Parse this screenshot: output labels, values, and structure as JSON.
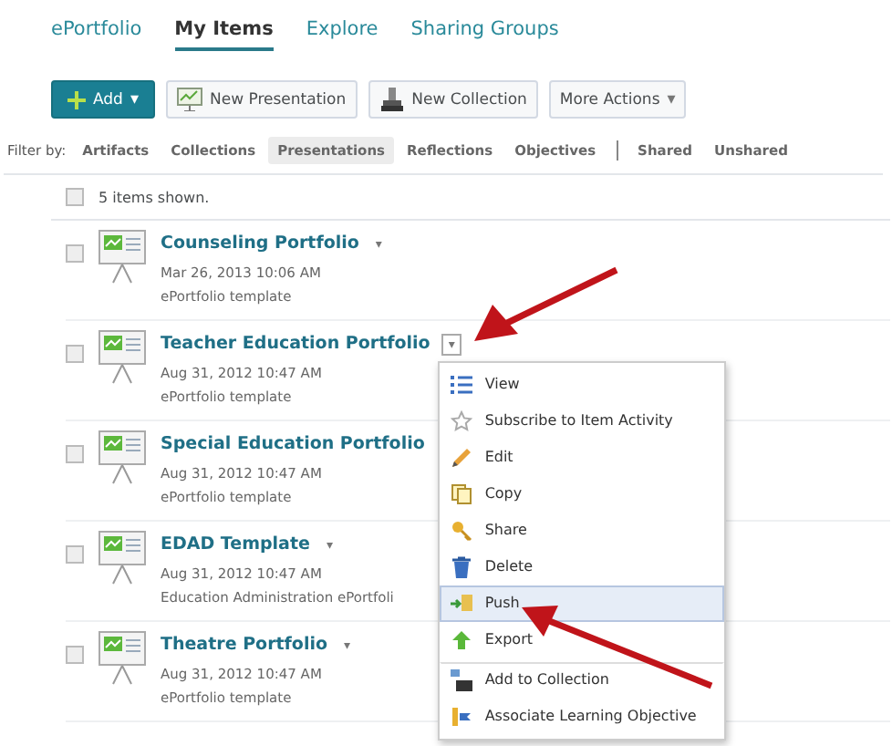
{
  "tabs": [
    {
      "label": "ePortfolio",
      "selected": false
    },
    {
      "label": "My Items",
      "selected": true
    },
    {
      "label": "Explore",
      "selected": false
    },
    {
      "label": "Sharing Groups",
      "selected": false
    }
  ],
  "toolbar": {
    "add_button": {
      "label": "Add",
      "caret": "▾"
    },
    "buttons": [
      {
        "label": "New Presentation"
      },
      {
        "label": "New Collection"
      }
    ],
    "more_button": {
      "label": "More Actions",
      "caret": "▾"
    }
  },
  "filter": {
    "label": "Filter by:",
    "options": [
      {
        "label": "Artifacts",
        "selected": false
      },
      {
        "label": "Collections",
        "selected": false
      },
      {
        "label": "Presentations",
        "selected": true
      },
      {
        "label": "Reflections",
        "selected": false
      },
      {
        "label": "Objectives",
        "selected": false
      }
    ],
    "share_options": [
      {
        "label": "Shared",
        "selected": false
      },
      {
        "label": "Unshared",
        "selected": false
      }
    ]
  },
  "summary": {
    "text": "5 items shown.",
    "checked": false
  },
  "items": [
    {
      "title": "Counseling Portfolio",
      "date": "Mar 26, 2013 10:06 AM",
      "description": "ePortfolio template",
      "checked": false,
      "caret": "▾",
      "menu_open": false
    },
    {
      "title": "Teacher Education Portfolio",
      "date": "Aug 31, 2012 10:47 AM",
      "description": "ePortfolio template",
      "checked": false,
      "caret": "▾",
      "menu_open": true
    },
    {
      "title": "Special Education Portfolio",
      "date": "Aug 31, 2012 10:47 AM",
      "description": "ePortfolio template",
      "checked": false,
      "menu_open": false
    },
    {
      "title": "EDAD Template",
      "date": "Aug 31, 2012 10:47 AM",
      "description": "Education Administration ePortfoli",
      "checked": false,
      "caret": "▾",
      "menu_open": false
    },
    {
      "title": "Theatre Portfolio",
      "date": "Aug 31, 2012 10:47 AM",
      "description": "ePortfolio template",
      "checked": false,
      "caret": "▾",
      "menu_open": false
    }
  ],
  "context_menu": {
    "items": [
      {
        "label": "View",
        "selected": false,
        "separator_before": false
      },
      {
        "label": "Subscribe to Item Activity",
        "selected": false,
        "separator_before": false
      },
      {
        "label": "Edit",
        "selected": false,
        "separator_before": false
      },
      {
        "label": "Copy",
        "selected": false,
        "separator_before": false
      },
      {
        "label": "Share",
        "selected": false,
        "separator_before": false
      },
      {
        "label": "Delete",
        "selected": false,
        "separator_before": false
      },
      {
        "label": "Push",
        "selected": true,
        "separator_before": false
      },
      {
        "label": "Export",
        "selected": false,
        "separator_before": false
      },
      {
        "label": "Add to Collection",
        "selected": false,
        "separator_before": true
      },
      {
        "label": "Associate Learning Objective",
        "selected": false,
        "separator_before": false
      }
    ]
  }
}
